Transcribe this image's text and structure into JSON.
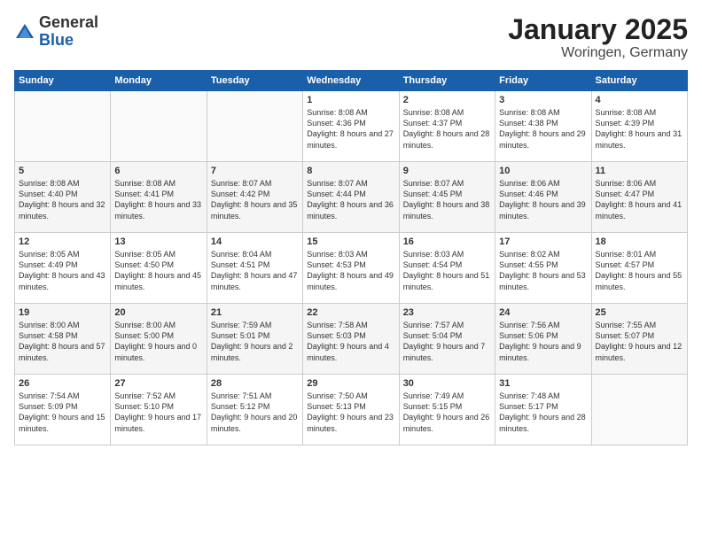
{
  "logo": {
    "general": "General",
    "blue": "Blue"
  },
  "header": {
    "title": "January 2025",
    "subtitle": "Woringen, Germany"
  },
  "weekdays": [
    "Sunday",
    "Monday",
    "Tuesday",
    "Wednesday",
    "Thursday",
    "Friday",
    "Saturday"
  ],
  "weeks": [
    [
      {
        "day": "",
        "info": ""
      },
      {
        "day": "",
        "info": ""
      },
      {
        "day": "",
        "info": ""
      },
      {
        "day": "1",
        "info": "Sunrise: 8:08 AM\nSunset: 4:36 PM\nDaylight: 8 hours\nand 27 minutes."
      },
      {
        "day": "2",
        "info": "Sunrise: 8:08 AM\nSunset: 4:37 PM\nDaylight: 8 hours\nand 28 minutes."
      },
      {
        "day": "3",
        "info": "Sunrise: 8:08 AM\nSunset: 4:38 PM\nDaylight: 8 hours\nand 29 minutes."
      },
      {
        "day": "4",
        "info": "Sunrise: 8:08 AM\nSunset: 4:39 PM\nDaylight: 8 hours\nand 31 minutes."
      }
    ],
    [
      {
        "day": "5",
        "info": "Sunrise: 8:08 AM\nSunset: 4:40 PM\nDaylight: 8 hours\nand 32 minutes."
      },
      {
        "day": "6",
        "info": "Sunrise: 8:08 AM\nSunset: 4:41 PM\nDaylight: 8 hours\nand 33 minutes."
      },
      {
        "day": "7",
        "info": "Sunrise: 8:07 AM\nSunset: 4:42 PM\nDaylight: 8 hours\nand 35 minutes."
      },
      {
        "day": "8",
        "info": "Sunrise: 8:07 AM\nSunset: 4:44 PM\nDaylight: 8 hours\nand 36 minutes."
      },
      {
        "day": "9",
        "info": "Sunrise: 8:07 AM\nSunset: 4:45 PM\nDaylight: 8 hours\nand 38 minutes."
      },
      {
        "day": "10",
        "info": "Sunrise: 8:06 AM\nSunset: 4:46 PM\nDaylight: 8 hours\nand 39 minutes."
      },
      {
        "day": "11",
        "info": "Sunrise: 8:06 AM\nSunset: 4:47 PM\nDaylight: 8 hours\nand 41 minutes."
      }
    ],
    [
      {
        "day": "12",
        "info": "Sunrise: 8:05 AM\nSunset: 4:49 PM\nDaylight: 8 hours\nand 43 minutes."
      },
      {
        "day": "13",
        "info": "Sunrise: 8:05 AM\nSunset: 4:50 PM\nDaylight: 8 hours\nand 45 minutes."
      },
      {
        "day": "14",
        "info": "Sunrise: 8:04 AM\nSunset: 4:51 PM\nDaylight: 8 hours\nand 47 minutes."
      },
      {
        "day": "15",
        "info": "Sunrise: 8:03 AM\nSunset: 4:53 PM\nDaylight: 8 hours\nand 49 minutes."
      },
      {
        "day": "16",
        "info": "Sunrise: 8:03 AM\nSunset: 4:54 PM\nDaylight: 8 hours\nand 51 minutes."
      },
      {
        "day": "17",
        "info": "Sunrise: 8:02 AM\nSunset: 4:55 PM\nDaylight: 8 hours\nand 53 minutes."
      },
      {
        "day": "18",
        "info": "Sunrise: 8:01 AM\nSunset: 4:57 PM\nDaylight: 8 hours\nand 55 minutes."
      }
    ],
    [
      {
        "day": "19",
        "info": "Sunrise: 8:00 AM\nSunset: 4:58 PM\nDaylight: 8 hours\nand 57 minutes."
      },
      {
        "day": "20",
        "info": "Sunrise: 8:00 AM\nSunset: 5:00 PM\nDaylight: 9 hours\nand 0 minutes."
      },
      {
        "day": "21",
        "info": "Sunrise: 7:59 AM\nSunset: 5:01 PM\nDaylight: 9 hours\nand 2 minutes."
      },
      {
        "day": "22",
        "info": "Sunrise: 7:58 AM\nSunset: 5:03 PM\nDaylight: 9 hours\nand 4 minutes."
      },
      {
        "day": "23",
        "info": "Sunrise: 7:57 AM\nSunset: 5:04 PM\nDaylight: 9 hours\nand 7 minutes."
      },
      {
        "day": "24",
        "info": "Sunrise: 7:56 AM\nSunset: 5:06 PM\nDaylight: 9 hours\nand 9 minutes."
      },
      {
        "day": "25",
        "info": "Sunrise: 7:55 AM\nSunset: 5:07 PM\nDaylight: 9 hours\nand 12 minutes."
      }
    ],
    [
      {
        "day": "26",
        "info": "Sunrise: 7:54 AM\nSunset: 5:09 PM\nDaylight: 9 hours\nand 15 minutes."
      },
      {
        "day": "27",
        "info": "Sunrise: 7:52 AM\nSunset: 5:10 PM\nDaylight: 9 hours\nand 17 minutes."
      },
      {
        "day": "28",
        "info": "Sunrise: 7:51 AM\nSunset: 5:12 PM\nDaylight: 9 hours\nand 20 minutes."
      },
      {
        "day": "29",
        "info": "Sunrise: 7:50 AM\nSunset: 5:13 PM\nDaylight: 9 hours\nand 23 minutes."
      },
      {
        "day": "30",
        "info": "Sunrise: 7:49 AM\nSunset: 5:15 PM\nDaylight: 9 hours\nand 26 minutes."
      },
      {
        "day": "31",
        "info": "Sunrise: 7:48 AM\nSunset: 5:17 PM\nDaylight: 9 hours\nand 28 minutes."
      },
      {
        "day": "",
        "info": ""
      }
    ]
  ]
}
